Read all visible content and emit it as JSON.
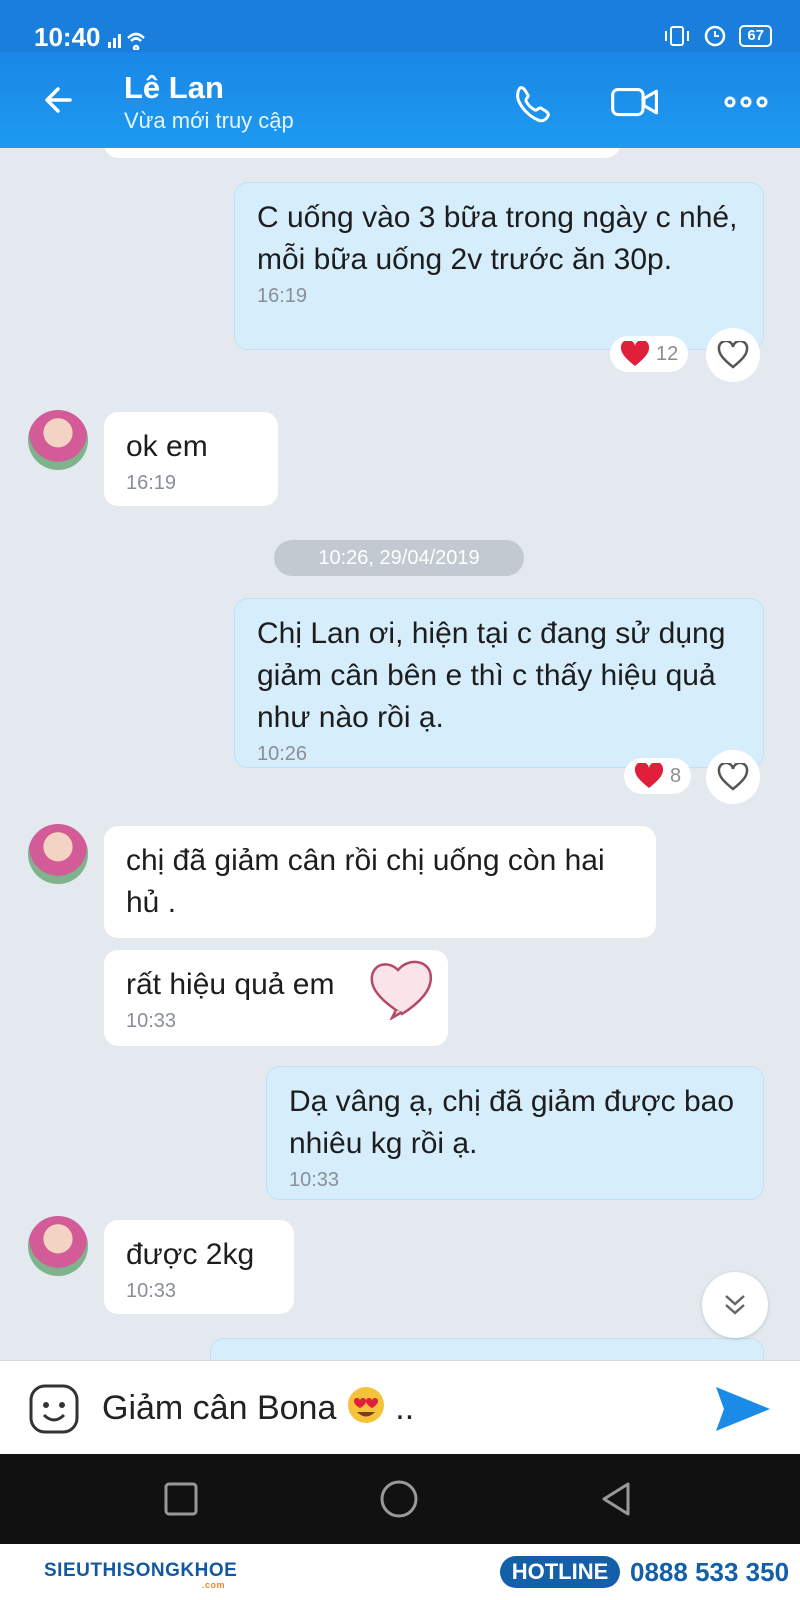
{
  "status_bar": {
    "time": "10:40",
    "battery": "67"
  },
  "header": {
    "name": "Lê Lan",
    "status": "Vừa mới truy cập"
  },
  "chat": {
    "messages": [
      {
        "from": "me",
        "text": "C uống vào 3 bữa trong ngày c nhé, mỗi bữa uống 2v trước ăn 30p.",
        "time": "16:19",
        "reaction_count": "12"
      },
      {
        "from": "contact",
        "text": "ok em",
        "time": "16:19"
      },
      {
        "from": "me",
        "text": "Chị Lan ơi, hiện tại c đang sử dụng giảm cân bên e thì c thấy hiệu quả như nào rồi ạ.",
        "time": "10:26",
        "reaction_count": "8"
      },
      {
        "from": "contact",
        "text": "chị đã giảm cân rồi chị uống còn hai hủ  ."
      },
      {
        "from": "contact",
        "text": "rất hiệu quả em",
        "time": "10:33"
      },
      {
        "from": "me",
        "text": "Dạ vâng ạ, chị đã giảm được bao nhiêu kg rồi ạ.",
        "time": "10:33"
      },
      {
        "from": "contact",
        "text": "được 2kg",
        "time": "10:33"
      }
    ],
    "date_separator": "10:26, 29/04/2019"
  },
  "input": {
    "value": "Giảm cân Bona",
    "suffix": ".."
  },
  "banner": {
    "brand": "SIEUTHISONGKHOE",
    "brand_domain": ".com",
    "hotline_label": "HOTLINE",
    "hotline_number": "0888 533 350"
  },
  "colors": {
    "header": "#1a87e6",
    "out_bubble": "#d6eefc",
    "in_bubble": "#ffffff",
    "heart": "#e0203a",
    "send": "#1a8be6"
  }
}
